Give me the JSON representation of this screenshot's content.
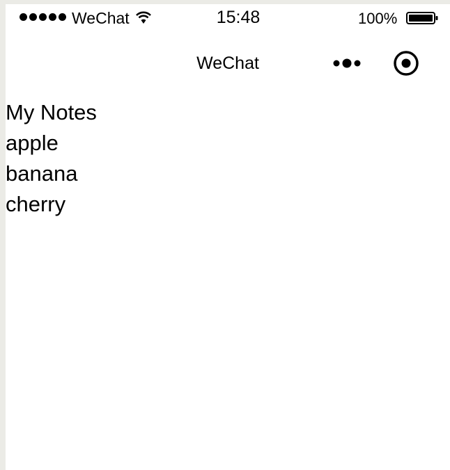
{
  "status_bar": {
    "carrier": "WeChat",
    "time": "15:48",
    "battery": "100%",
    "signal_bars": 5,
    "icons": [
      "signal-dots-icon",
      "wifi-icon",
      "battery-icon"
    ]
  },
  "nav_bar": {
    "title": "WeChat",
    "icons": [
      "more-dots-icon",
      "record-circle-icon"
    ]
  },
  "content": {
    "title": "My Notes",
    "items": [
      "apple",
      "banana",
      "cherry"
    ]
  }
}
